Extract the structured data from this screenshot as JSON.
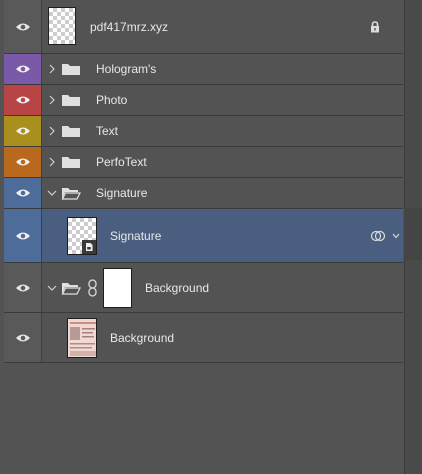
{
  "panel": "Layers",
  "layers": [
    {
      "name": "pdf417mrz.xyz",
      "visible": true,
      "locked": true,
      "lock_icon": "lock-icon",
      "thumbnail": "transparent",
      "eye_color": "#595959"
    },
    {
      "name": "Hologram's",
      "visible": true,
      "type": "group",
      "expanded": false,
      "eye_color": "#7a5aa8"
    },
    {
      "name": "Photo",
      "visible": true,
      "type": "group",
      "expanded": false,
      "eye_color": "#b84545"
    },
    {
      "name": "Text",
      "visible": true,
      "type": "group",
      "expanded": false,
      "eye_color": "#a88f1e"
    },
    {
      "name": "PerfoText",
      "visible": true,
      "type": "group",
      "expanded": false,
      "eye_color": "#b8691e"
    },
    {
      "name": "Signature",
      "visible": true,
      "type": "group",
      "expanded": true,
      "eye_color": "#4e6c9a"
    },
    {
      "name": "Signature",
      "visible": true,
      "type": "smart-object",
      "selected": true,
      "effects_icon": "blend-effects-icon",
      "eye_color": "#4e6c9a"
    },
    {
      "name": "Background",
      "visible": true,
      "type": "group",
      "expanded": true,
      "has_mask": true,
      "link_icon": "link-icon",
      "eye_color": "#595959"
    },
    {
      "name": "Background",
      "visible": true,
      "type": "image",
      "thumbnail": "document-scan",
      "eye_color": "#595959"
    }
  ],
  "colors": {
    "panel_bg": "#535353",
    "selected_row": "#4a5f80",
    "divider": "#3a3a3a"
  }
}
